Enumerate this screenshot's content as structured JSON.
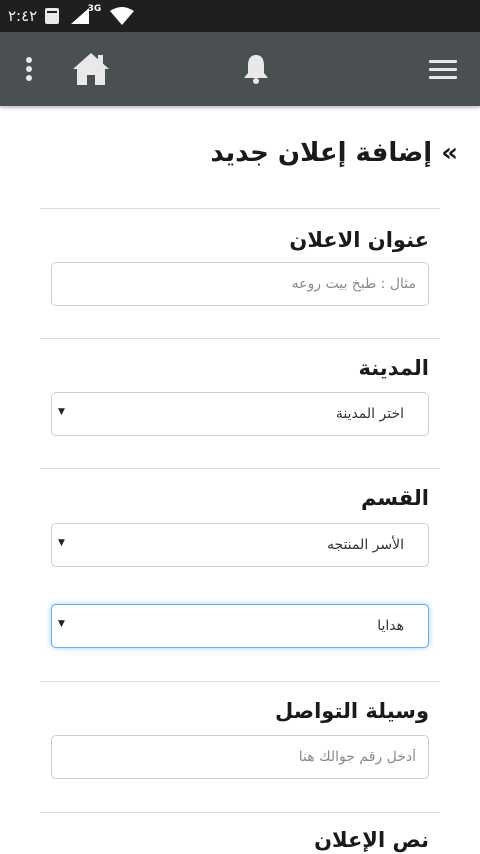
{
  "status_bar": {
    "time": "٢:٤٢",
    "calendar_icon": "calendar-icon",
    "signal_label": "3G",
    "wifi_icon": "wifi-icon"
  },
  "app_bar": {
    "background": "#4a4f52",
    "icons": [
      "kebab-menu-icon",
      "home-icon",
      "bell-icon",
      "hamburger-menu-icon"
    ]
  },
  "page": {
    "title": "» إضافة إعلان جديد"
  },
  "form": {
    "ad_title": {
      "label": "عنوان الاعلان",
      "placeholder": "مثال : طبخ بيت روعه",
      "value": ""
    },
    "city": {
      "label": "المدينة",
      "selected": "اختر المدينة"
    },
    "category": {
      "label": "القسم",
      "selected": "الأسر المنتجه",
      "subcategory_selected": "هدايا"
    },
    "contact": {
      "label": "وسيلة التواصل",
      "placeholder": "أدخل رقم جوالك هنا",
      "value": ""
    },
    "ad_text": {
      "label": "نص الإعلان"
    }
  },
  "colors": {
    "focus_border": "#66afe9",
    "status_bar": "#1f1f1f"
  }
}
